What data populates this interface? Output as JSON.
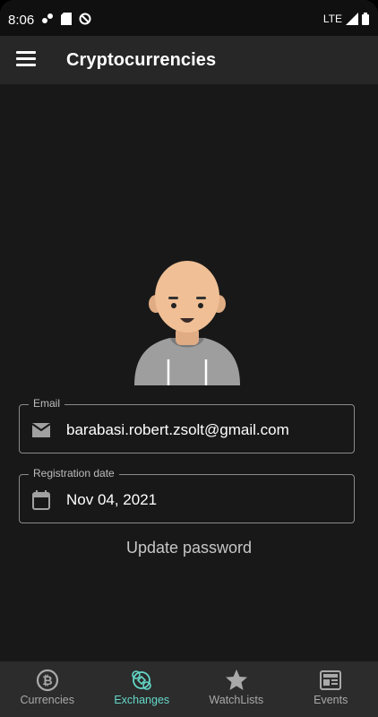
{
  "status_bar": {
    "time": "8:06",
    "network": "LTE"
  },
  "app_bar": {
    "title": "Cryptocurrencies",
    "menu_icon": "menu-icon"
  },
  "profile": {
    "avatar": "avatar-illustration",
    "email": {
      "label": "Email",
      "value": "barabasi.robert.zsolt@gmail.com",
      "icon": "mail-icon"
    },
    "registration": {
      "label": "Registration date",
      "value": "Nov 04, 2021",
      "icon": "calendar-icon"
    },
    "update_password_label": "Update password"
  },
  "bottom_nav": {
    "active_color": "#64d8c8",
    "items": [
      {
        "label": "Currencies",
        "icon": "bitcoin-icon",
        "active": false
      },
      {
        "label": "Exchanges",
        "icon": "exchange-icon",
        "active": true
      },
      {
        "label": "WatchLists",
        "icon": "star-icon",
        "active": false
      },
      {
        "label": "Events",
        "icon": "news-icon",
        "active": false
      }
    ]
  }
}
